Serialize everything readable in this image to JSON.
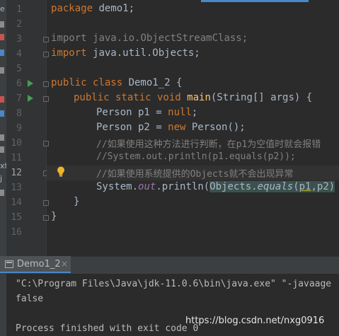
{
  "editor": {
    "line_numbers": [
      "1",
      "2",
      "3",
      "4",
      "5",
      "6",
      "7",
      "8",
      "9",
      "10",
      "11",
      "12",
      "13",
      "14",
      "15",
      "16"
    ],
    "current_line": 12,
    "lines": {
      "l1": {
        "kw": "package ",
        "rest": "demo1;"
      },
      "l3": {
        "kw": "import ",
        "rest": "java.io.ObjectStreamClass;"
      },
      "l4": {
        "kw": "import ",
        "rest": "java.util.Objects;"
      },
      "l6": {
        "kw": "public class ",
        "rest": "Demo1_2 {"
      },
      "l7": {
        "kw": "public static void ",
        "fn": "main",
        "rest": "(String[] args) {"
      },
      "l8": {
        "a": "Person p1 = ",
        "kw": "null",
        "b": ";"
      },
      "l9": {
        "a": "Person p2 = ",
        "kw": "new ",
        "b": "Person();"
      },
      "l10": {
        "comment": "//如果使用这种方法进行判断，在p1为空值时就会报错"
      },
      "l11": {
        "comment": "//System.out.println(p1.equals(p2));"
      },
      "l12": {
        "comment": "//如果使用系统提供的Objects就不会出现异常"
      },
      "l13": {
        "a": "System.",
        "field": "out",
        "b": ".println(",
        "c": "Objects.",
        "d": "equals",
        "e": "(",
        "f": "p1",
        "g": ",p2)",
        "h": ");"
      },
      "l15": {
        "text": "}"
      },
      "l16": {
        "text": "}"
      }
    }
  },
  "left_strip_fragments": [
    "e",
    "xt",
    "j"
  ],
  "run_panel": {
    "tab_label": "Demo1_2",
    "tab_close": "×",
    "lines": [
      "\"C:\\Program Files\\Java\\jdk-11.0.6\\bin\\java.exe\" \"-javaage",
      "false",
      "",
      "Process finished with exit code 0"
    ]
  },
  "watermark": "https://blog.csdn.net/nxg0916",
  "colors": {
    "background": "#2b2b2b",
    "keyword": "#cc7832",
    "method": "#ffc66d",
    "comment": "#808080",
    "field": "#9876aa",
    "run_icon": "#499c54"
  }
}
